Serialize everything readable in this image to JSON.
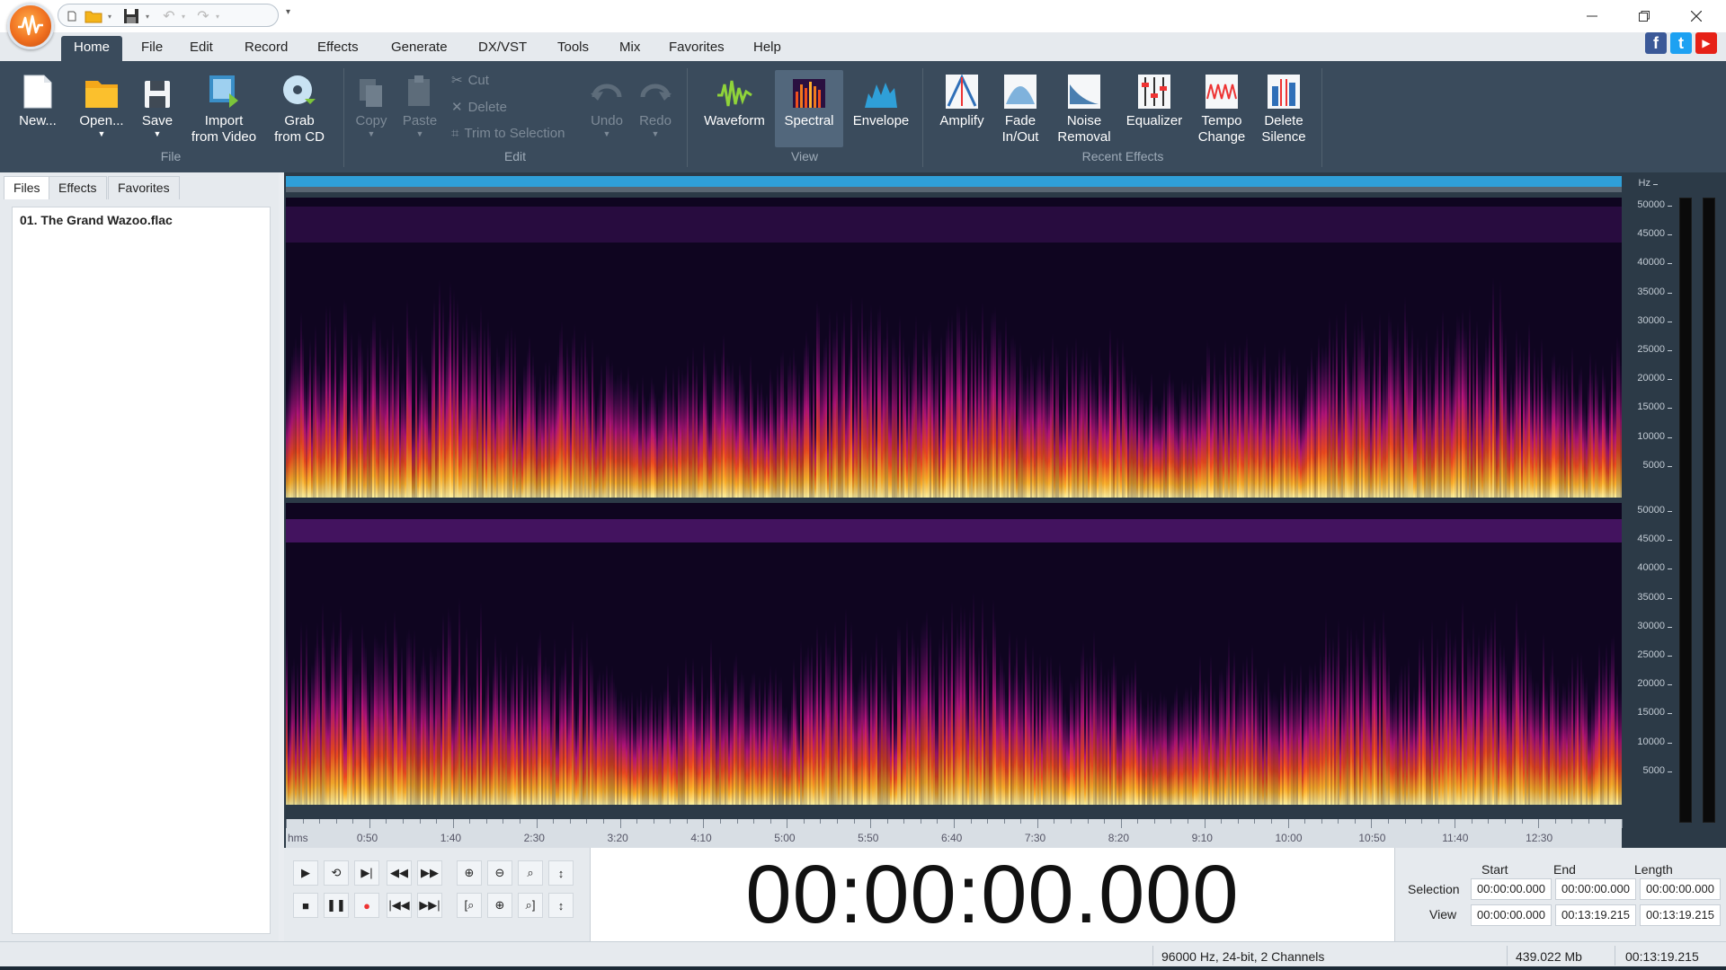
{
  "menu": {
    "tabs": [
      "Home",
      "File",
      "Edit",
      "Record",
      "Effects",
      "Generate",
      "DX/VST",
      "Tools",
      "Mix",
      "Favorites",
      "Help"
    ],
    "active": "Home"
  },
  "ribbon": {
    "file": {
      "new": "New...",
      "open": "Open...",
      "save": "Save",
      "import_l1": "Import",
      "import_l2": "from Video",
      "grab_l1": "Grab",
      "grab_l2": "from CD",
      "group": "File"
    },
    "edit": {
      "copy": "Copy",
      "paste": "Paste",
      "cut": "Cut",
      "delete": "Delete",
      "trim": "Trim to Selection",
      "undo": "Undo",
      "redo": "Redo",
      "group": "Edit"
    },
    "view": {
      "waveform": "Waveform",
      "spectral": "Spectral",
      "envelope": "Envelope",
      "group": "View"
    },
    "effects": {
      "amplify": "Amplify",
      "fade_l1": "Fade",
      "fade_l2": "In/Out",
      "noise_l1": "Noise",
      "noise_l2": "Removal",
      "equalizer": "Equalizer",
      "tempo_l1": "Tempo",
      "tempo_l2": "Change",
      "silence_l1": "Delete",
      "silence_l2": "Silence",
      "group": "Recent Effects"
    }
  },
  "left_panel": {
    "tabs": {
      "files": "Files",
      "effects": "Effects",
      "favorites": "Favorites"
    },
    "file": "01. The Grand Wazoo.flac"
  },
  "axis": {
    "unit": "Hz",
    "hz_ticks": [
      "50000",
      "45000",
      "40000",
      "35000",
      "30000",
      "25000",
      "20000",
      "15000",
      "10000",
      "5000"
    ],
    "time_unit": "hms",
    "time_ticks": [
      "0:50",
      "1:40",
      "2:30",
      "3:20",
      "4:10",
      "5:00",
      "5:50",
      "6:40",
      "7:30",
      "8:20",
      "9:10",
      "10:00",
      "10:50",
      "11:40",
      "12:30"
    ]
  },
  "clock": "00:00:00.000",
  "selection": {
    "head_start": "Start",
    "head_end": "End",
    "head_length": "Length",
    "sel_label": "Selection",
    "view_label": "View",
    "sel_start": "00:00:00.000",
    "sel_end": "00:00:00.000",
    "sel_length": "00:00:00.000",
    "view_start": "00:00:00.000",
    "view_end": "00:13:19.215",
    "view_length": "00:13:19.215"
  },
  "status": {
    "format": "96000 Hz, 24-bit, 2 Channels",
    "size": "439.022 Mb",
    "duration": "00:13:19.215"
  },
  "colors": {
    "ribbon_bg": "#3a4b5c",
    "accent": "#2f9fd8",
    "spectrum_bg": "#0f0520"
  }
}
